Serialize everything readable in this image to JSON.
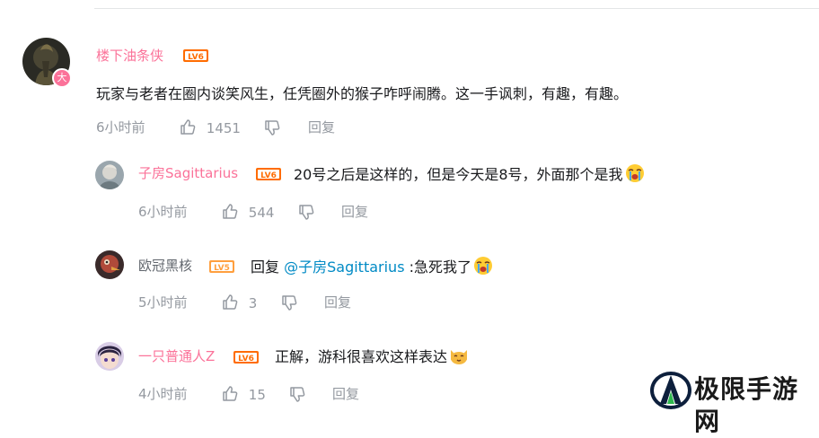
{
  "comments": [
    {
      "username": "楼下油条侠",
      "level": "LV6",
      "badge": "大",
      "content": "玩家与老者在圈内谈笑风生，任凭圈外的猴子咋呼闹腾。这一手讽刺，有趣，有趣。",
      "time": "6小时前",
      "likes": "1451",
      "reply_label": "回复",
      "replies": [
        {
          "username": "子房Sagittarius",
          "level": "LV6",
          "content": "20号之后是这样的，但是今天是8号，外面那个是我",
          "emoji": "crying-face-emoji",
          "time": "6小时前",
          "likes": "544",
          "reply_label": "回复"
        },
        {
          "username": "欧冠黑核",
          "level": "LV5",
          "reply_prefix": "回复",
          "mention": "@子房Sagittarius",
          "content": ":急死我了",
          "emoji": "crying-face-emoji",
          "time": "5小时前",
          "likes": "3",
          "reply_label": "回复"
        },
        {
          "username": "一只普通人Z",
          "level": "LV6",
          "content": "正解，游科很喜欢这样表达",
          "emoji": "cat-face-emoji",
          "time": "4小时前",
          "likes": "15",
          "reply_label": "回复"
        }
      ]
    }
  ],
  "watermark": {
    "text": "极限手游网"
  },
  "colors": {
    "vip_name": "#fb7299",
    "normal_name": "#61666d",
    "mention": "#008ac5",
    "meta": "#9499a0",
    "level6": "#ff6c00",
    "level5": "#ff9f3e"
  },
  "icons": [
    "like-icon",
    "dislike-icon"
  ]
}
